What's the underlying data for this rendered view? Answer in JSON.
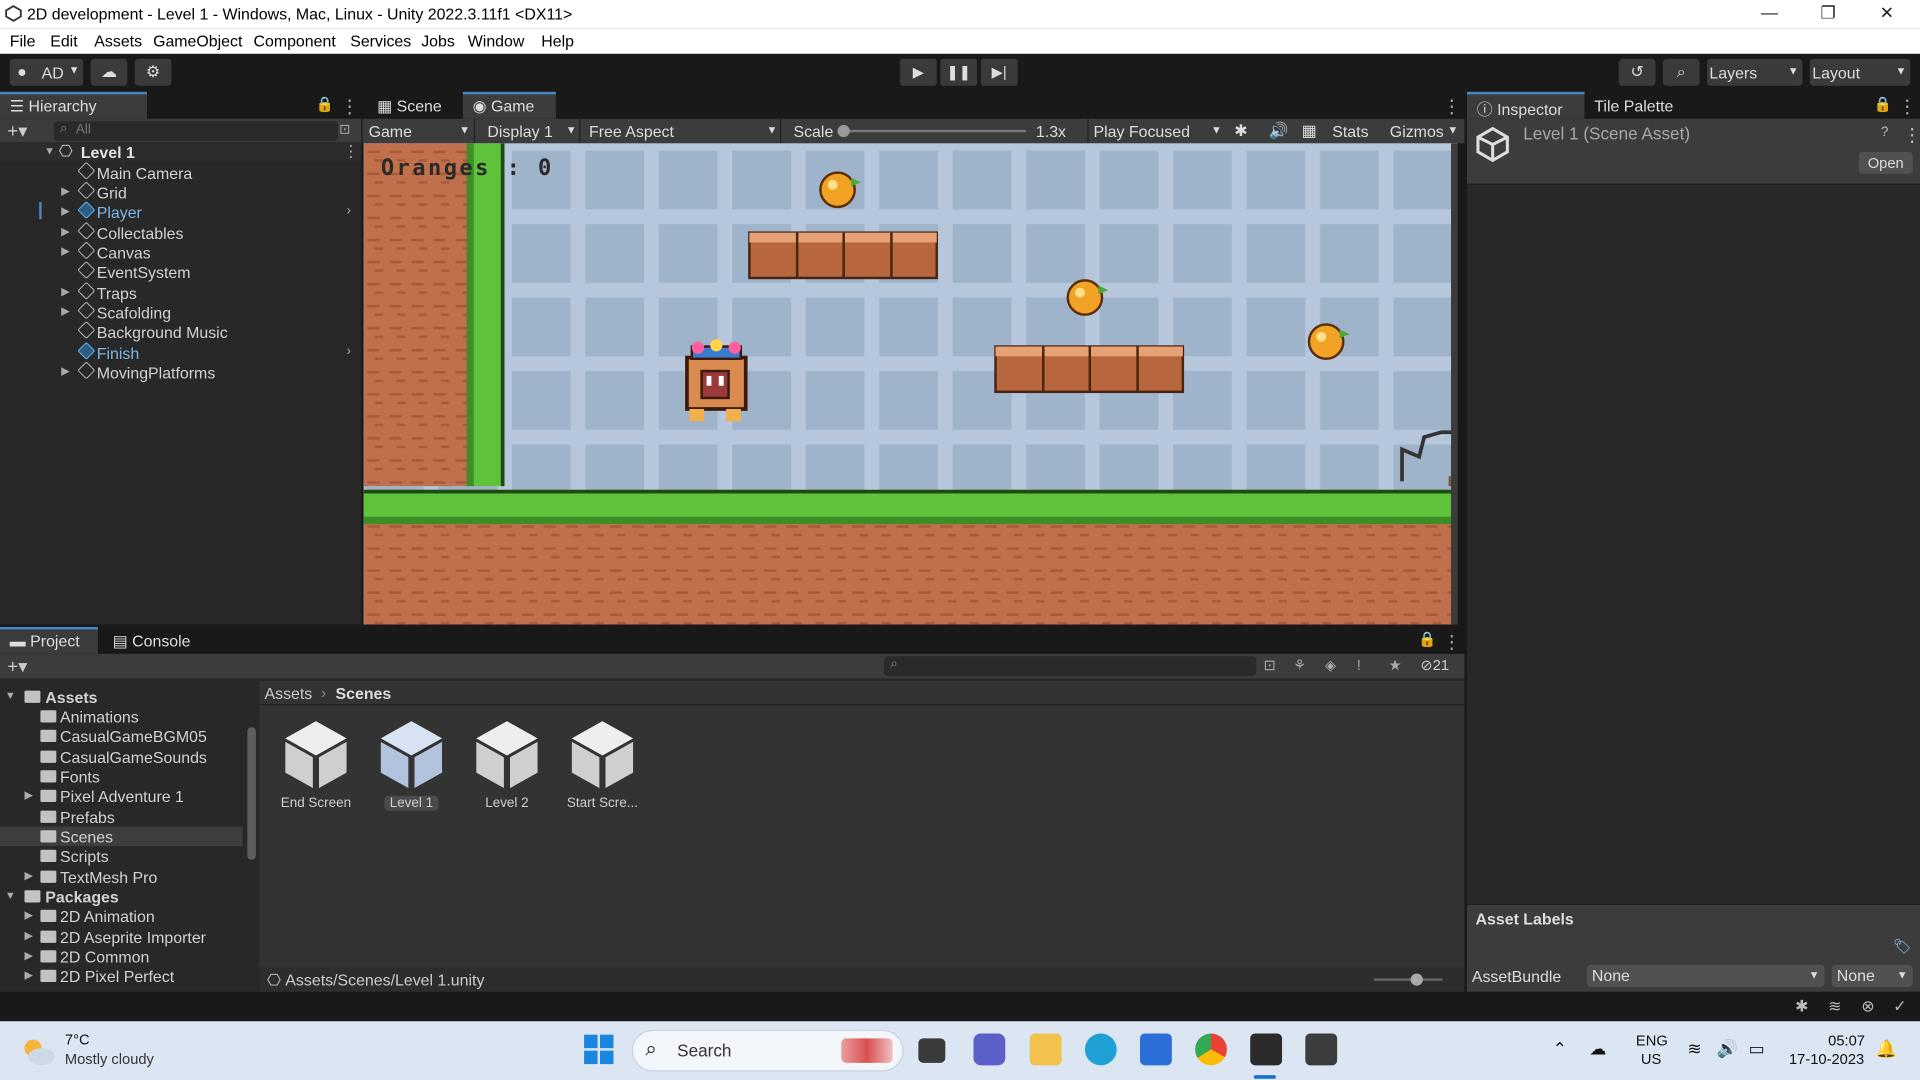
{
  "window": {
    "title": "2D development - Level 1 - Windows, Mac, Linux - Unity 2022.3.11f1 <DX11>"
  },
  "menu": [
    "File",
    "Edit",
    "Assets",
    "GameObject",
    "Component",
    "Services",
    "Jobs",
    "Window",
    "Help"
  ],
  "toolbar": {
    "account": "AD",
    "layers": "Layers",
    "layout": "Layout"
  },
  "hierarchy": {
    "tab": "Hierarchy",
    "search_placeholder": "All",
    "scene": "Level 1",
    "items": [
      "Main Camera",
      "Grid",
      "Player",
      "Collectables",
      "Canvas",
      "EventSystem",
      "Traps",
      "Scafolding",
      "Background Music",
      "Finish",
      "MovingPlatforms"
    ]
  },
  "game_view": {
    "tabs": {
      "scene": "Scene",
      "game": "Game"
    },
    "mode": "Game",
    "display": "Display 1",
    "aspect": "Free Aspect",
    "scale_label": "Scale",
    "scale_value": "1.3x",
    "play_mode": "Play Focused",
    "stats": "Stats",
    "gizmos": "Gizmos",
    "score_text": "Oranges : 0"
  },
  "inspector": {
    "tab": "Inspector",
    "tab2": "Tile Palette",
    "asset_title": "Level 1 (Scene Asset)",
    "open_button": "Open",
    "asset_labels": "Asset Labels",
    "assetbundle_label": "AssetBundle",
    "assetbundle_value": "None",
    "variant_value": "None"
  },
  "project": {
    "tab": "Project",
    "console_tab": "Console",
    "hidden_count": "21",
    "breadcrumb_root": "Assets",
    "breadcrumb_current": "Scenes",
    "tree": {
      "assets_root": "Assets",
      "assets": [
        "Animations",
        "CasualGameBGM05",
        "CasualGameSounds",
        "Fonts",
        "Pixel Adventure 1",
        "Prefabs",
        "Scenes",
        "Scripts",
        "TextMesh Pro"
      ],
      "packages_root": "Packages",
      "packages": [
        "2D Animation",
        "2D Aseprite Importer",
        "2D Common",
        "2D Pixel Perfect"
      ]
    },
    "scenes": [
      "End Screen",
      "Level 1",
      "Level 2",
      "Start Scre..."
    ],
    "status_path": "Assets/Scenes/Level 1.unity"
  },
  "taskbar": {
    "temperature": "7°C",
    "weather": "Mostly cloudy",
    "search": "Search",
    "lang1": "ENG",
    "lang2": "US",
    "time": "05:07",
    "date": "17-10-2023"
  }
}
